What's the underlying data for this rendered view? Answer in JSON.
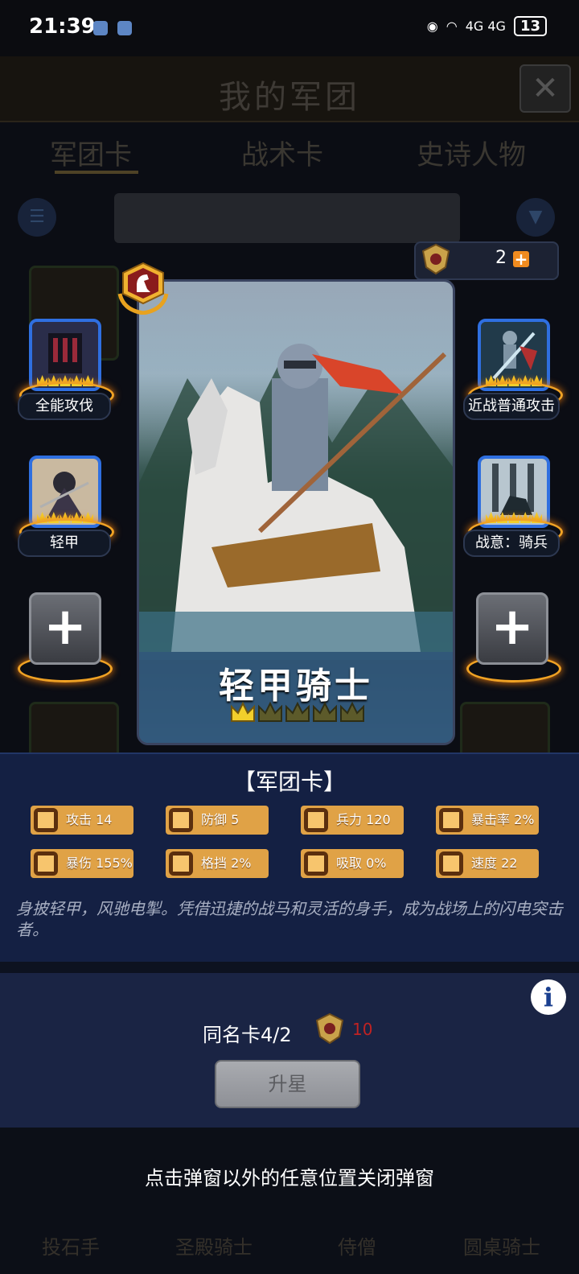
{
  "status_bar": {
    "time": "21:39",
    "indicators": "4G 4G",
    "battery": "13"
  },
  "background": {
    "title": "我的军团",
    "close_icon": "close-icon",
    "tabs": [
      {
        "label": "军团卡"
      },
      {
        "label": "战术卡"
      },
      {
        "label": "史诗人物"
      }
    ],
    "grid_labels": [
      "投石手",
      "圣殿骑士",
      "侍僧",
      "圆桌骑士"
    ]
  },
  "count_box": {
    "value": "2",
    "plus": "+"
  },
  "card": {
    "name": "轻甲骑士",
    "crowns_filled": 1,
    "crowns_total": 5
  },
  "skills": {
    "left_top": {
      "label": "全能攻伐"
    },
    "left_mid": {
      "label": "轻甲"
    },
    "right_top": {
      "label": "近战普通攻击"
    },
    "right_mid": {
      "label": "战意：骑兵"
    }
  },
  "info": {
    "title": "【军团卡】",
    "stats": [
      {
        "label": "攻击",
        "value": "14"
      },
      {
        "label": "防御",
        "value": "5"
      },
      {
        "label": "兵力",
        "value": "120"
      },
      {
        "label": "暴击率",
        "value": "2%"
      },
      {
        "label": "暴伤",
        "value": "155%"
      },
      {
        "label": "格挡",
        "value": "2%"
      },
      {
        "label": "吸取",
        "value": "0%"
      },
      {
        "label": "速度",
        "value": "22"
      }
    ],
    "description": "身披轻甲，风驰电掣。凭借迅捷的战马和灵活的身手，成为战场上的闪电突击者。"
  },
  "upgrade": {
    "same_card": "同名卡4/2",
    "cost": "10",
    "button": "升星"
  },
  "hint": "点击弹窗以外的任意位置关闭弹窗",
  "colors": {
    "accent_gold": "#e0a246",
    "slot_blue": "#2f6fe0",
    "panel": "#142043",
    "cost_red": "#c02222"
  }
}
